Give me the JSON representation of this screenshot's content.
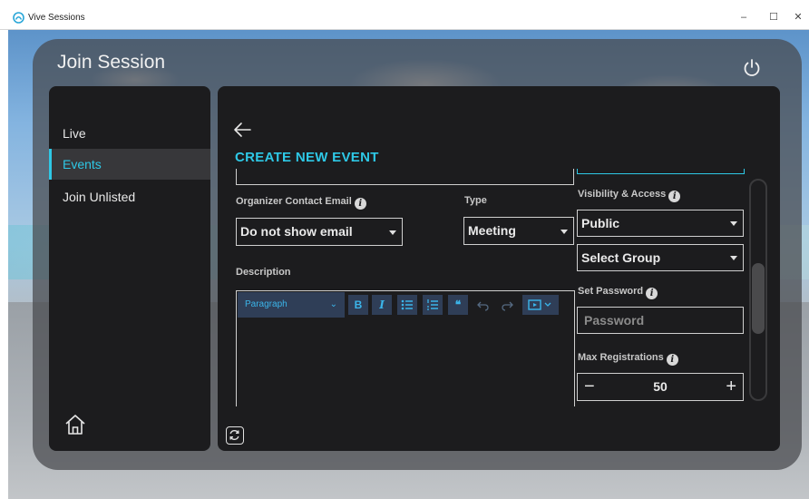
{
  "window": {
    "title": "Vive Sessions",
    "min_glyph": "–",
    "max_glyph": "☐",
    "close_glyph": "✕"
  },
  "page": {
    "title": "Join Session"
  },
  "sidebar": {
    "items": [
      {
        "label": "Live"
      },
      {
        "label": "Events"
      },
      {
        "label": "Join Unlisted"
      }
    ],
    "active": "Events"
  },
  "form": {
    "heading": "CREATE NEW EVENT",
    "organizer_email": {
      "label": "Organizer Contact Email",
      "value": "Do not show email"
    },
    "type": {
      "label": "Type",
      "value": "Meeting"
    },
    "description": {
      "label": "Description"
    },
    "visibility": {
      "label": "Visibility & Access",
      "value": "Public"
    },
    "group": {
      "value": "Select Group"
    },
    "password": {
      "label": "Set Password",
      "placeholder": "Password"
    },
    "max_registrations": {
      "label": "Max Registrations",
      "value": "50",
      "minus": "−",
      "plus": "+"
    }
  },
  "editor_toolbar": {
    "paragraph": "Paragraph",
    "bold": "B",
    "italic": "I",
    "quote": "❝",
    "chevron": "⌄"
  },
  "info_glyph": "i",
  "colors": {
    "accent": "#2ec8e6",
    "panel": "#1c1c1e",
    "toolbar_button": "#2f3e57"
  }
}
